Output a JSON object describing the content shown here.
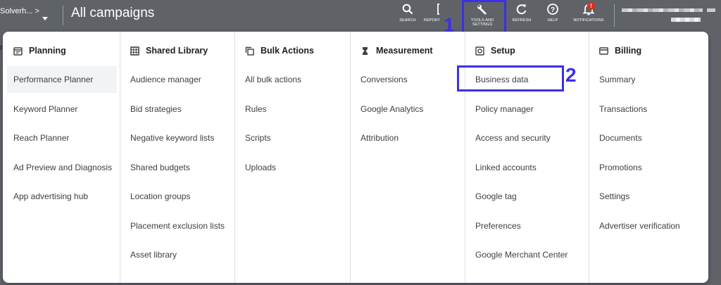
{
  "header": {
    "account": "Solverh... >",
    "title": "All campaigns",
    "tools": [
      {
        "label": "SEARCH",
        "icon": "search-icon"
      },
      {
        "label": "REPORTS",
        "icon": "reports-icon"
      },
      {
        "label": "TOOLS AND SETTINGS",
        "icon": "wrench-icon"
      },
      {
        "label": "REFRESH",
        "icon": "refresh-icon"
      },
      {
        "label": "HELP",
        "icon": "help-icon"
      },
      {
        "label": "NOTIFICATIONS",
        "icon": "bell-icon",
        "badge": "!"
      }
    ]
  },
  "left_strip": "r",
  "columns": [
    {
      "heading": "Planning",
      "icon": "calendar-icon",
      "items": [
        "Performance Planner",
        "Keyword Planner",
        "Reach Planner",
        "Ad Preview and Diagnosis",
        "App advertising hub"
      ],
      "selected": "Performance Planner"
    },
    {
      "heading": "Shared Library",
      "icon": "library-grid-icon",
      "items": [
        "Audience manager",
        "Bid strategies",
        "Negative keyword lists",
        "Shared budgets",
        "Location groups",
        "Placement exclusion lists",
        "Asset library"
      ]
    },
    {
      "heading": "Bulk Actions",
      "icon": "copy-icon",
      "items": [
        "All bulk actions",
        "Rules",
        "Scripts",
        "Uploads"
      ]
    },
    {
      "heading": "Measurement",
      "icon": "hourglass-icon",
      "items": [
        "Conversions",
        "Google Analytics",
        "Attribution"
      ]
    },
    {
      "heading": "Setup",
      "icon": "setup-gear-icon",
      "items": [
        "Business data",
        "Policy manager",
        "Access and security",
        "Linked accounts",
        "Google tag",
        "Preferences",
        "Google Merchant Center"
      ]
    },
    {
      "heading": "Billing",
      "icon": "credit-card-icon",
      "items": [
        "Summary",
        "Transactions",
        "Documents",
        "Promotions",
        "Settings",
        "Advertiser verification"
      ]
    }
  ],
  "annotations": [
    {
      "number": "1",
      "target": "TOOLS AND SETTINGS"
    },
    {
      "number": "2",
      "target": "Business data"
    }
  ],
  "colors": {
    "topbar": "#5f6368",
    "annotation": "#3b30e6",
    "selected_bg": "#f1f3f4",
    "badge": "#d93025"
  }
}
